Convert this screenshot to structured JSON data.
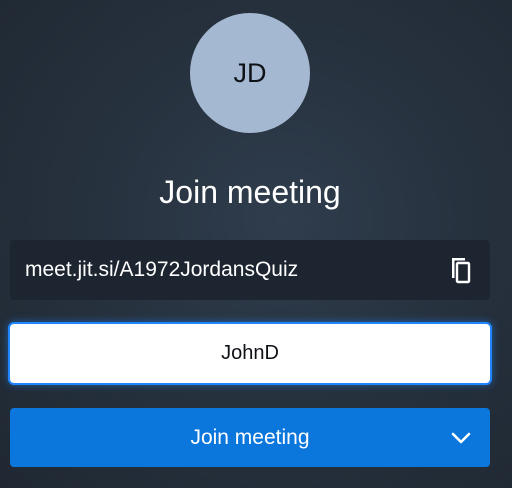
{
  "avatar": {
    "initials": "JD",
    "color": "#a4b8d1"
  },
  "title": "Join meeting",
  "meeting": {
    "url": "meet.jit.si/A1972JordansQuiz",
    "copy_icon": "copy-icon"
  },
  "name_input": {
    "value": "JohnD"
  },
  "join_button": {
    "label": "Join meeting",
    "color": "#0b76dc",
    "options_icon": "chevron-down-icon"
  }
}
